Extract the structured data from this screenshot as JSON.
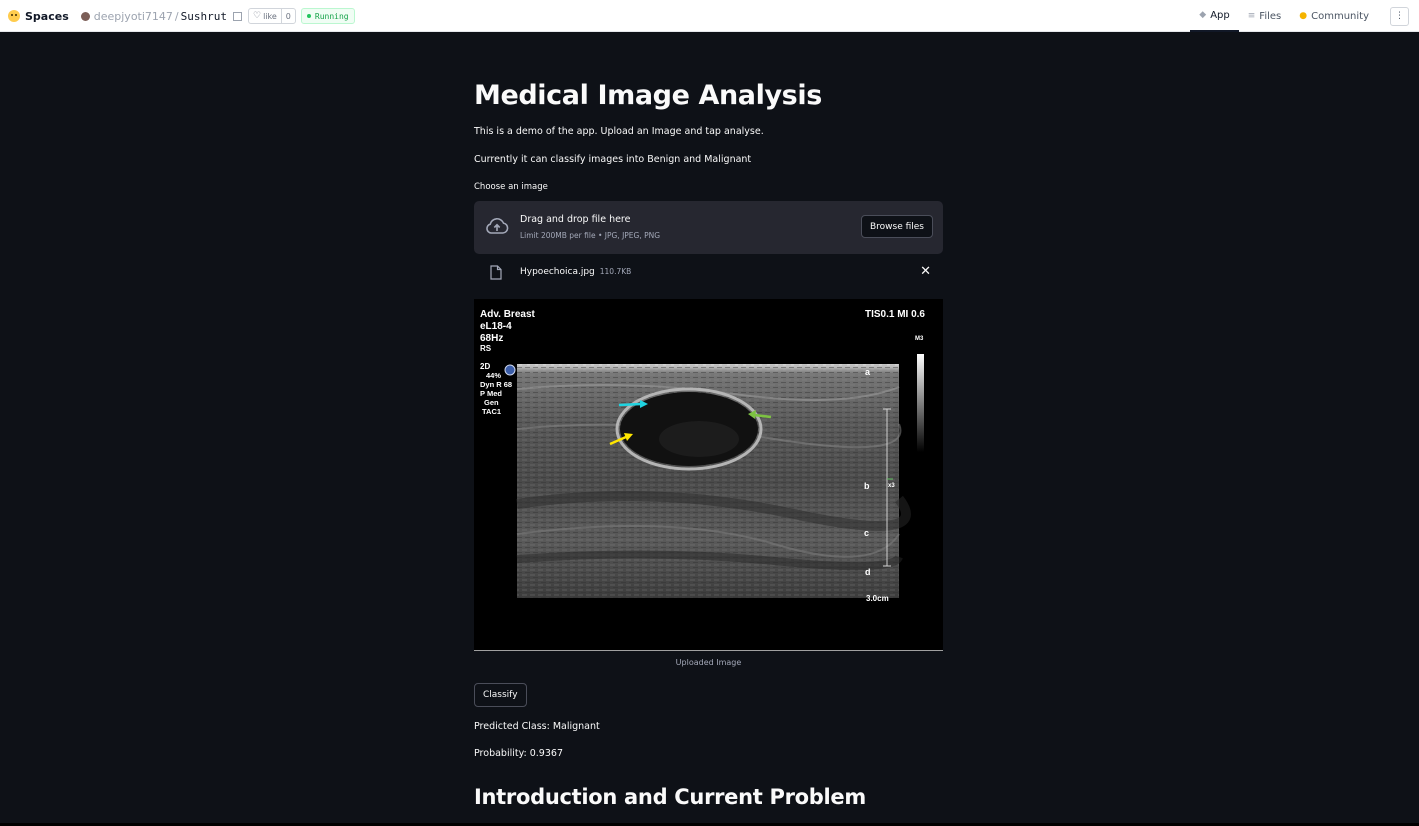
{
  "topbar": {
    "spaces_label": "Spaces",
    "owner": "deepjyoti7147",
    "separator": "/",
    "repo": "Sushrut",
    "like_label": "like",
    "like_count": "0",
    "status": "Running",
    "tabs": [
      {
        "label": "App",
        "icon": "app-icon"
      },
      {
        "label": "Files",
        "icon": "files-icon"
      },
      {
        "label": "Community",
        "icon": "community-icon"
      }
    ],
    "more_icon": "more-icon"
  },
  "main": {
    "title": "Medical Image Analysis",
    "intro": "This is a demo of the app. Upload an Image and tap analyse.",
    "capability": "Currently it can classify images into Benign and Malignant",
    "uploader_label": "Choose an image",
    "dropzone_title": "Drag and drop file here",
    "dropzone_sub": "Limit 200MB per file • JPG, JPEG, PNG",
    "browse_label": "Browse files",
    "file_name": "Hypoechoica.jpg",
    "file_size": "110.7KB",
    "image_caption": "Uploaded Image",
    "classify_label": "Classify",
    "predicted": "Predicted Class: Malignant",
    "probability": "Probability: 0.9367",
    "section_heading": "Introduction and Current Problem"
  },
  "ultrasound": {
    "top_left": [
      "Adv. Breast",
      "eL18-4",
      "68Hz",
      "RS"
    ],
    "side_params": [
      "2D",
      "44%",
      "Dyn R 68",
      "P Med",
      "Gen",
      "TAC1"
    ],
    "top_right": "TIS0.1   MI 0.6",
    "gray_label": "M3",
    "markers": [
      "a",
      "b",
      "c",
      "d"
    ],
    "x_mark": "x3",
    "depth": "3.0cm"
  },
  "colors": {
    "background": "#0e1117",
    "widget_bg": "#262730",
    "arrow_cyan": "#1fd3e0",
    "arrow_green": "#7dc242",
    "arrow_yellow": "#ffe600"
  }
}
